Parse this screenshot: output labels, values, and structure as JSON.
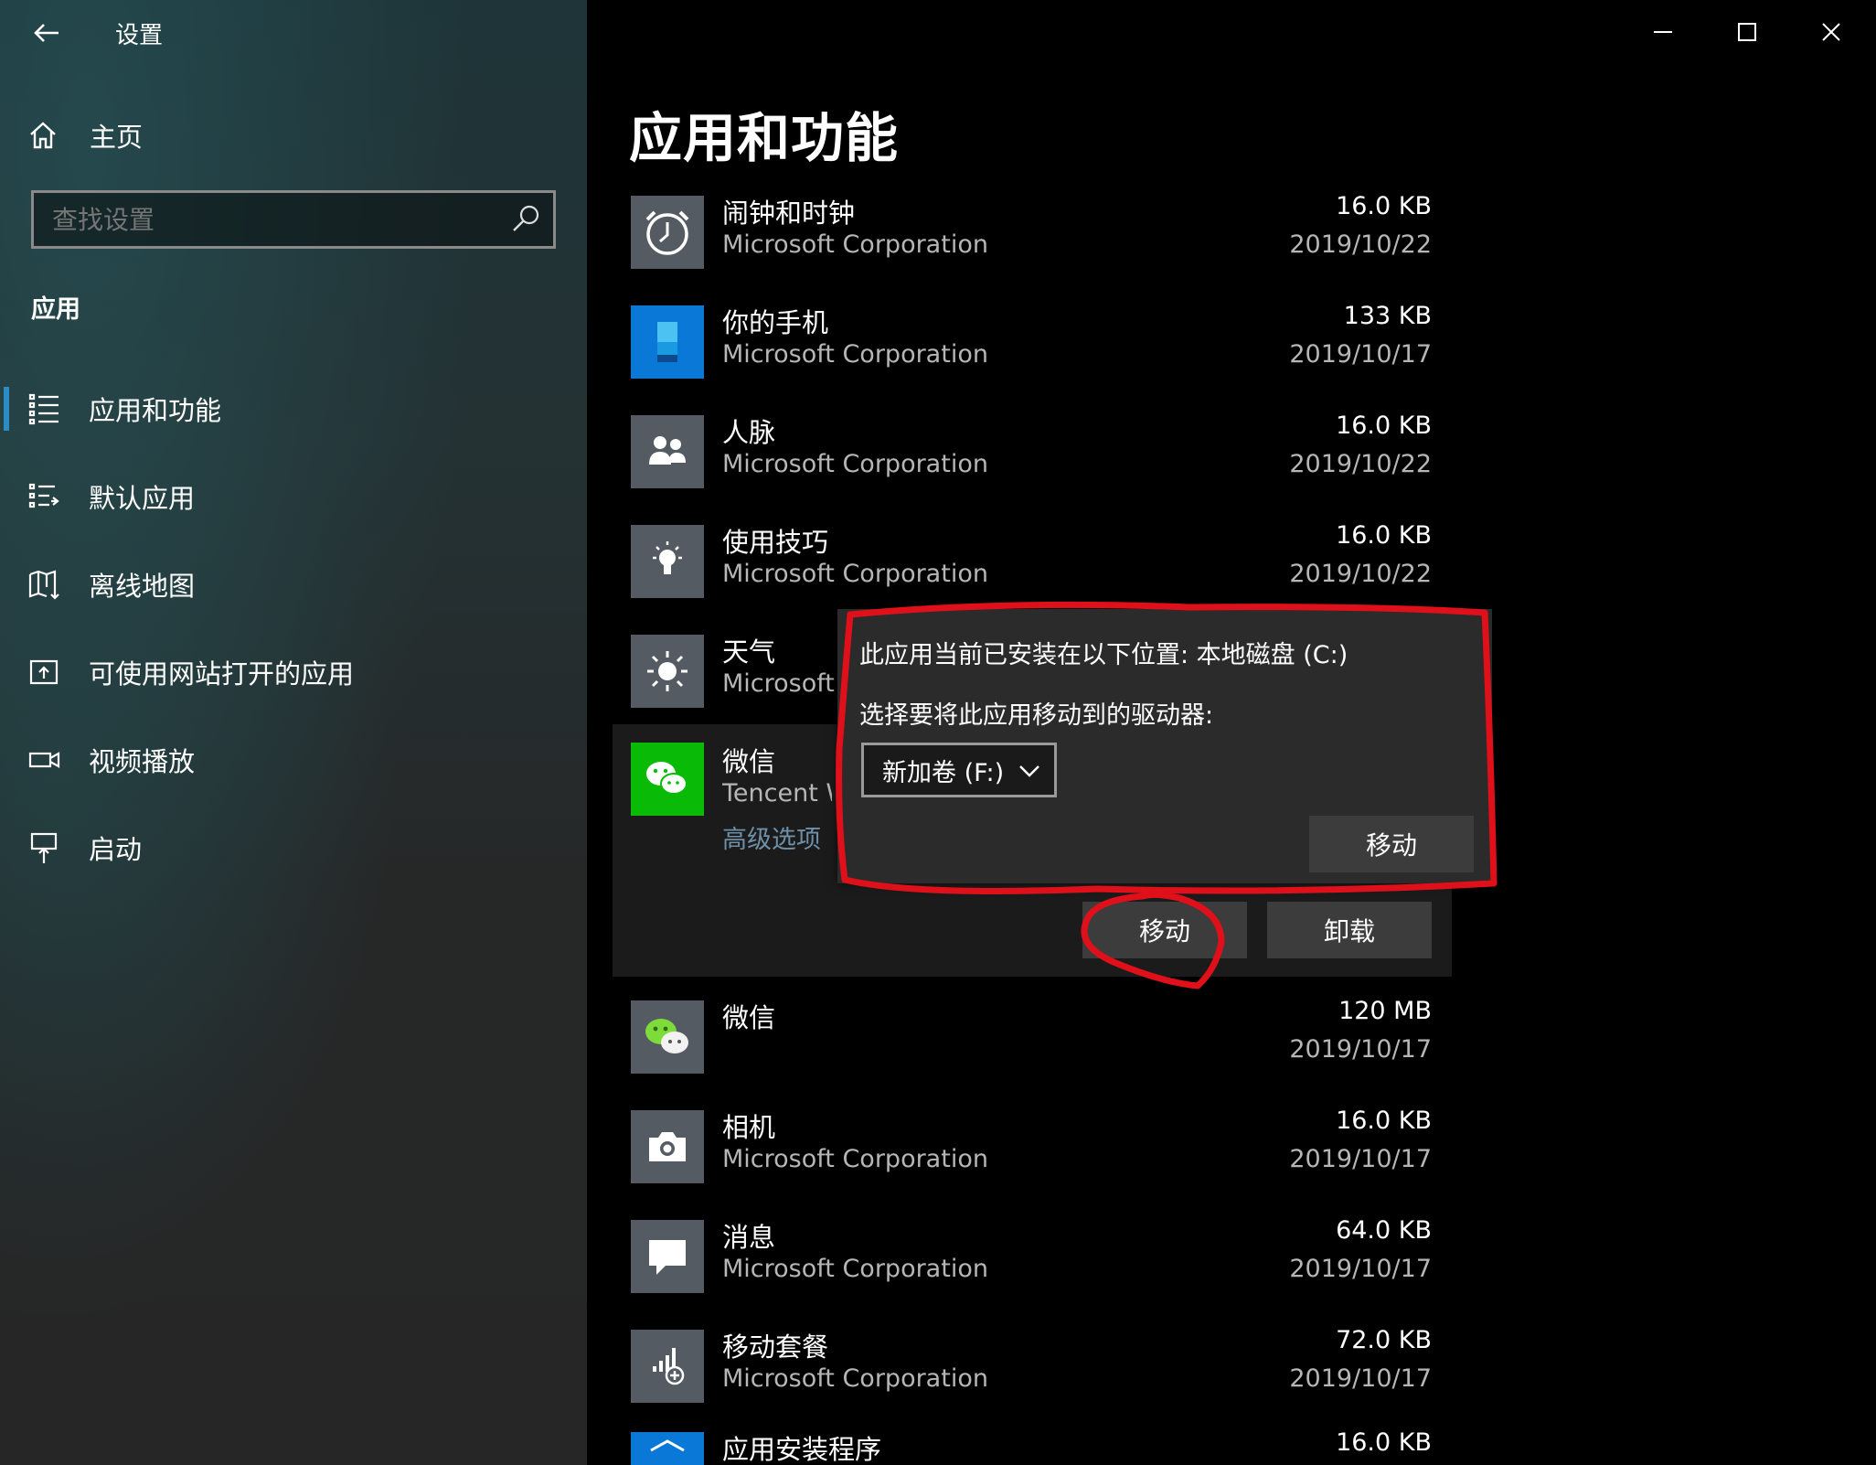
{
  "window": {
    "title": "设置",
    "controls": [
      "minimize",
      "maximize",
      "close"
    ]
  },
  "sidebar": {
    "home_label": "主页",
    "search_placeholder": "查找设置",
    "section_label": "应用",
    "items": [
      {
        "label": "应用和功能",
        "icon": "apps-list-icon",
        "active": true
      },
      {
        "label": "默认应用",
        "icon": "default-apps-icon",
        "active": false
      },
      {
        "label": "离线地图",
        "icon": "offline-map-icon",
        "active": false
      },
      {
        "label": "可使用网站打开的应用",
        "icon": "website-apps-icon",
        "active": false
      },
      {
        "label": "视频播放",
        "icon": "video-icon",
        "active": false
      },
      {
        "label": "启动",
        "icon": "startup-icon",
        "active": false
      }
    ]
  },
  "main": {
    "title": "应用和功能",
    "apps": [
      {
        "name": "闹钟和时钟",
        "publisher": "Microsoft Corporation",
        "size": "16.0 KB",
        "date": "2019/10/22",
        "icon": "alarm-clock-icon"
      },
      {
        "name": "你的手机",
        "publisher": "Microsoft Corporation",
        "size": "133 KB",
        "date": "2019/10/17",
        "icon": "phone-icon"
      },
      {
        "name": "人脉",
        "publisher": "Microsoft Corporation",
        "size": "16.0 KB",
        "date": "2019/10/22",
        "icon": "people-icon"
      },
      {
        "name": "使用技巧",
        "publisher": "Microsoft Corporation",
        "size": "16.0 KB",
        "date": "2019/10/22",
        "icon": "tips-lightbulb-icon"
      },
      {
        "name": "天气",
        "publisher": "Microsoft",
        "size": "",
        "date": "",
        "icon": "weather-sun-icon"
      }
    ],
    "expanded_app": {
      "name": "微信",
      "publisher": "Tencent W",
      "advanced_options": "高级选项",
      "move_button": "移动",
      "uninstall_button": "卸载",
      "icon": "wechat-icon"
    },
    "apps_after": [
      {
        "name": "微信",
        "publisher": "",
        "size": "120 MB",
        "date": "2019/10/17",
        "icon": "wechat-desktop-icon"
      },
      {
        "name": "相机",
        "publisher": "Microsoft Corporation",
        "size": "16.0 KB",
        "date": "2019/10/17",
        "icon": "camera-icon"
      },
      {
        "name": "消息",
        "publisher": "Microsoft Corporation",
        "size": "64.0 KB",
        "date": "2019/10/17",
        "icon": "message-icon"
      },
      {
        "name": "移动套餐",
        "publisher": "Microsoft Corporation",
        "size": "72.0 KB",
        "date": "2019/10/17",
        "icon": "mobile-plans-icon"
      },
      {
        "name": "应用安装程序",
        "publisher": "",
        "size": "16.0 KB",
        "date": "",
        "icon": "app-installer-icon"
      }
    ]
  },
  "flyout": {
    "current_location": "此应用当前已安装在以下位置: 本地磁盘 (C:)",
    "choose_drive": "选择要将此应用移动到的驱动器:",
    "selected_drive": "新加卷 (F:)",
    "move_button": "移动"
  },
  "colors": {
    "accent": "#2e8cc4",
    "tile_gray": "#545b62",
    "phone_blue": "#0a78d7",
    "wechat_green": "#09bb07",
    "annotation_red": "#e0101a"
  }
}
